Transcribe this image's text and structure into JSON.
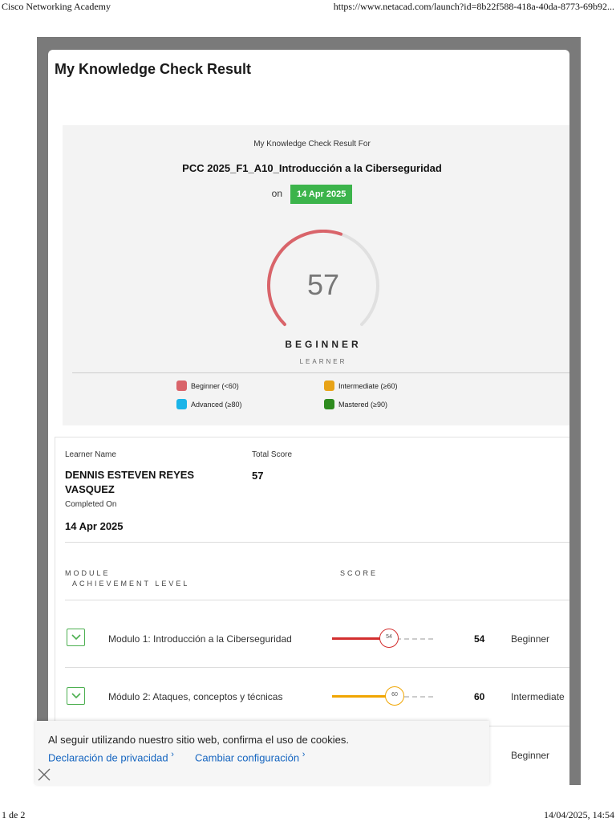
{
  "print_header": {
    "title": "Cisco Networking Academy",
    "url": "https://www.netacad.com/launch?id=8b22f588-418a-40da-8773-69b92..."
  },
  "print_footer": {
    "page": "1 de 2",
    "datetime": "14/04/2025, 14:54"
  },
  "card": {
    "title": "My Knowledge Check Result"
  },
  "summary": {
    "for_label": "My Knowledge Check Result For",
    "course": "PCC 2025_F1_A10_Introducción a la Ciberseguridad",
    "on_label": "on",
    "date": "14 Apr 2025",
    "score": "57",
    "score_fraction": 0.57,
    "level": "BEGINNER",
    "level_sub": "LEARNER",
    "gauge_color": "#d9646a",
    "gauge_track_color": "#e0e0e0"
  },
  "legend": [
    {
      "label": "Beginner (<60)",
      "color": "#d9646a"
    },
    {
      "label": "Intermediate (≥60)",
      "color": "#e8a317"
    },
    {
      "label": "Advanced (≥80)",
      "color": "#1ab4e8"
    },
    {
      "label": "Mastered (≥90)",
      "color": "#2e8b1e"
    }
  ],
  "details": {
    "learner_name_label": "Learner Name",
    "learner_name": "DENNIS ESTEVEN REYES VASQUEZ",
    "total_score_label": "Total Score",
    "total_score": "57",
    "completed_on_label": "Completed On",
    "completed_on": "14 Apr 2025",
    "col_module": "MODULE",
    "col_achievement": "ACHIEVEMENT LEVEL",
    "col_score": "SCORE"
  },
  "modules": [
    {
      "name": "Modulo 1: Introducción a la Ciberseguridad",
      "score": "54",
      "fraction": 0.54,
      "level": "Beginner",
      "color": "#d32f2f"
    },
    {
      "name": "Módulo 2: Ataques, conceptos y técnicas",
      "score": "60",
      "fraction": 0.6,
      "level": "Intermediate",
      "color": "#f0a500"
    },
    {
      "name": "",
      "score": "",
      "fraction": 0,
      "level": "Beginner",
      "color": "#d32f2f"
    }
  ],
  "cookie": {
    "message": "Al seguir utilizando nuestro sitio web, confirma el uso de cookies.",
    "privacy_link": "Declaración de privacidad",
    "settings_link": "Cambiar configuración",
    "close_icon": "close-icon"
  }
}
